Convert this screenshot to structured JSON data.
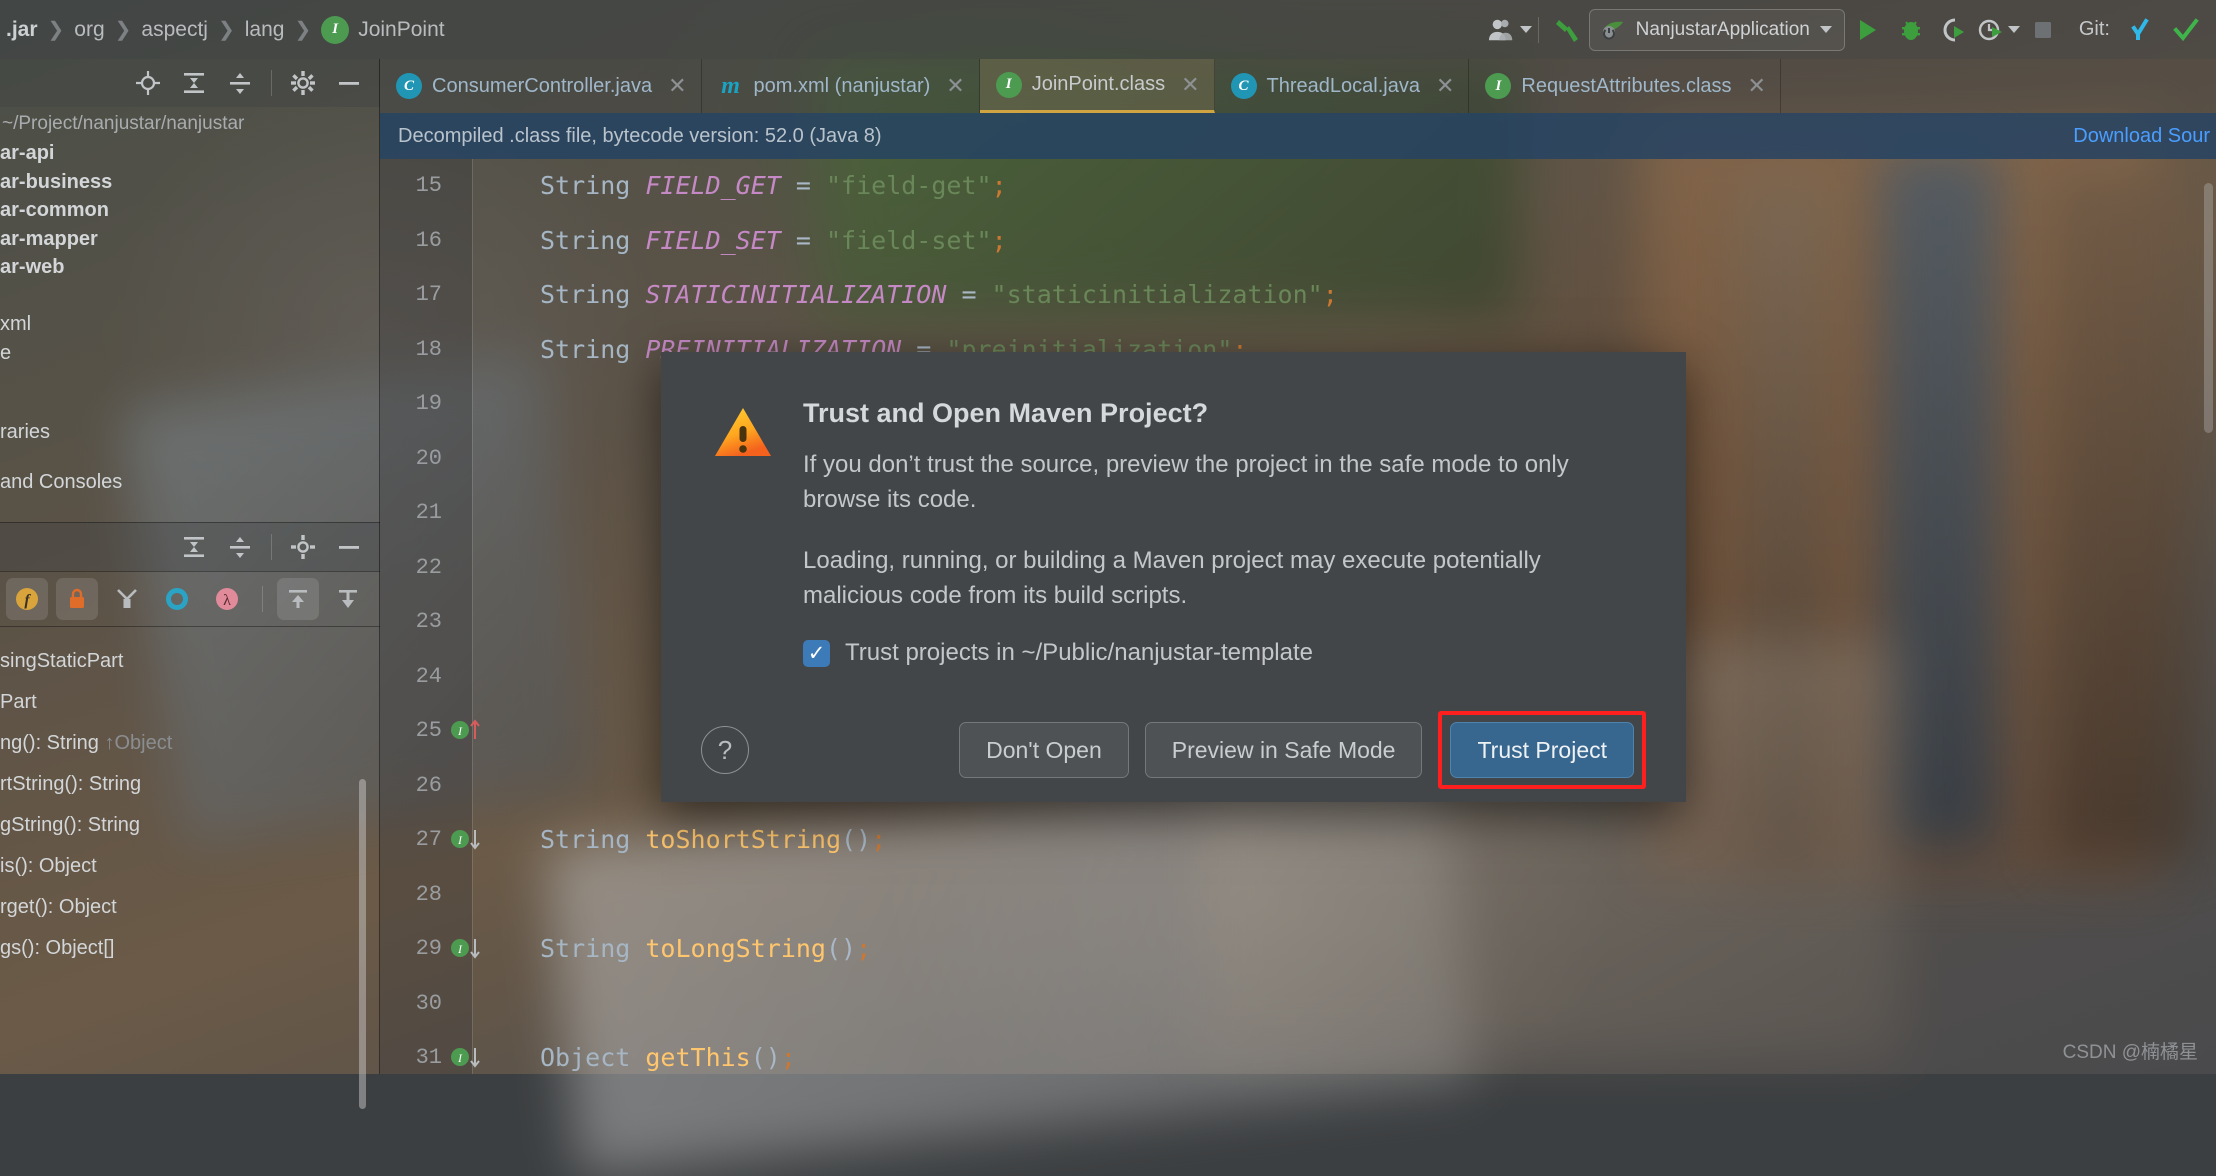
{
  "toolbar": {
    "breadcrumb": [
      {
        "label": ".jar",
        "bold": true
      },
      {
        "label": "org",
        "bold": false
      },
      {
        "label": "aspectj",
        "bold": false
      },
      {
        "label": "lang",
        "bold": false
      },
      {
        "label": "JoinPoint",
        "bold": false,
        "icon": "interface-badge",
        "badge_letter": "I"
      }
    ],
    "separator": "❯",
    "icons": [
      {
        "name": "user-account-icon",
        "glyph": "👤"
      },
      {
        "name": "build-hammer-icon",
        "glyph": "hammer"
      }
    ],
    "run_config": {
      "label": "NanjustarApplication",
      "icon": "spring-boot-icon"
    },
    "run_icons": [
      {
        "name": "run-button",
        "glyph": "▶"
      },
      {
        "name": "debug-button",
        "glyph": "bug"
      },
      {
        "name": "run-with-coverage-button",
        "glyph": "coverage"
      },
      {
        "name": "profiler-button",
        "glyph": "profiler"
      },
      {
        "name": "stop-button",
        "glyph": "■"
      }
    ],
    "git_label": "Git:",
    "git_icons": [
      {
        "name": "git-update-project-icon",
        "glyph": "↙"
      },
      {
        "name": "git-commit-icon",
        "glyph": "✓"
      }
    ]
  },
  "project_panel": {
    "toolbar_icons": [
      {
        "name": "select-opened-file-icon"
      },
      {
        "name": "expand-all-icon"
      },
      {
        "name": "collapse-all-icon"
      },
      {
        "name": "settings-gear-icon"
      },
      {
        "name": "hide-panel-icon"
      }
    ],
    "path": "~/Project/nanjustar/nanjustar",
    "tree": [
      {
        "label": "ar-api",
        "bold": true
      },
      {
        "label": "ar-business",
        "bold": true
      },
      {
        "label": "ar-common",
        "bold": true
      },
      {
        "label": "ar-mapper",
        "bold": true
      },
      {
        "label": "ar-web",
        "bold": true
      },
      {
        "label": "",
        "bold": false
      },
      {
        "label": "xml",
        "bold": false
      },
      {
        "label": "e",
        "bold": false
      },
      {
        "label": "",
        "bold": false
      },
      {
        "label": "raries",
        "bold": false
      },
      {
        "label": "and Consoles",
        "bold": false
      }
    ],
    "split_toolbar_icons": [
      {
        "name": "expand-all-icon"
      },
      {
        "name": "collapse-all-icon"
      },
      {
        "name": "settings-gear-icon"
      },
      {
        "name": "hide-panel-icon"
      }
    ],
    "structure_icons": [
      {
        "name": "fields-filter-icon",
        "glyph": "f",
        "color": "#d9a43b"
      },
      {
        "name": "non-public-filter-icon",
        "glyph": "lock",
        "color": "#e06c29"
      },
      {
        "name": "inherited-filter-icon",
        "glyph": "Y",
        "color": "#b9bcbe"
      },
      {
        "name": "properties-filter-icon",
        "glyph": "O",
        "color": "#2aa3c4"
      },
      {
        "name": "lambdas-filter-icon",
        "glyph": "λ",
        "color": "#e08a9a"
      },
      {
        "name": "expand-all-icon",
        "glyph": "up",
        "color": "#b9bcbe"
      },
      {
        "name": "collapse-all-icon",
        "glyph": "down",
        "color": "#b9bcbe"
      }
    ],
    "structure": [
      {
        "text": "singStaticPart",
        "dim": ""
      },
      {
        "text": "Part",
        "dim": ""
      },
      {
        "text": "ng(): String",
        "dim": "↑Object"
      },
      {
        "text": "rtString(): String",
        "dim": ""
      },
      {
        "text": "gString(): String",
        "dim": ""
      },
      {
        "text": "is(): Object",
        "dim": ""
      },
      {
        "text": "rget(): Object",
        "dim": ""
      },
      {
        "text": "gs(): Object[]",
        "dim": ""
      }
    ]
  },
  "editor_tabs": [
    {
      "label": "ConsumerController.java",
      "icon": "class-file-icon",
      "badge": "C",
      "active": false,
      "close": "✕"
    },
    {
      "label": "pom.xml (nanjustar)",
      "icon": "maven-file-icon",
      "badge": "m",
      "active": false,
      "close": "✕"
    },
    {
      "label": "JoinPoint.class",
      "icon": "interface-file-icon",
      "badge": "I",
      "active": true,
      "close": "✕"
    },
    {
      "label": "ThreadLocal.java",
      "icon": "class-file-icon",
      "badge": "C",
      "active": false,
      "close": "✕"
    },
    {
      "label": "RequestAttributes.class",
      "icon": "interface-file-icon",
      "badge": "I",
      "active": false,
      "close": "✕"
    }
  ],
  "notification": {
    "message": "Decompiled .class file, bytecode version: 52.0 (Java 8)",
    "action": "Download Sour"
  },
  "code": {
    "lines": [
      {
        "num": "15",
        "gutter": "",
        "tokens": [
          {
            "t": "String ",
            "c": "kw"
          },
          {
            "t": "FIELD_GET",
            "c": "fld"
          },
          {
            "t": " = ",
            "c": "op"
          },
          {
            "t": "\"field-get\"",
            "c": "str"
          },
          {
            "t": ";",
            "c": "semi"
          }
        ]
      },
      {
        "num": "16",
        "gutter": "",
        "tokens": [
          {
            "t": "String ",
            "c": "kw"
          },
          {
            "t": "FIELD_SET",
            "c": "fld"
          },
          {
            "t": " = ",
            "c": "op"
          },
          {
            "t": "\"field-set\"",
            "c": "str"
          },
          {
            "t": ";",
            "c": "semi"
          }
        ]
      },
      {
        "num": "17",
        "gutter": "",
        "tokens": [
          {
            "t": "String ",
            "c": "kw"
          },
          {
            "t": "STATICINITIALIZATION",
            "c": "fld"
          },
          {
            "t": " = ",
            "c": "op"
          },
          {
            "t": "\"staticinitialization\"",
            "c": "str"
          },
          {
            "t": ";",
            "c": "semi"
          }
        ]
      },
      {
        "num": "18",
        "gutter": "",
        "tokens": [
          {
            "t": "String ",
            "c": "kw"
          },
          {
            "t": "PREINITIALIZATION",
            "c": "fld"
          },
          {
            "t": " = ",
            "c": "op"
          },
          {
            "t": "\"preinitialization\"",
            "c": "str"
          },
          {
            "t": ";",
            "c": "semi"
          }
        ]
      },
      {
        "num": "19",
        "gutter": "",
        "tokens": []
      },
      {
        "num": "20",
        "gutter": "",
        "tokens": []
      },
      {
        "num": "21",
        "gutter": "",
        "tokens": []
      },
      {
        "num": "22",
        "gutter": "",
        "tokens": []
      },
      {
        "num": "23",
        "gutter": "",
        "tokens": []
      },
      {
        "num": "24",
        "gutter": "",
        "tokens": []
      },
      {
        "num": "25",
        "gutter": "impl-up",
        "tokens": []
      },
      {
        "num": "26",
        "gutter": "",
        "tokens": []
      },
      {
        "num": "27",
        "gutter": "impl-down",
        "tokens": [
          {
            "t": "String ",
            "c": "kw"
          },
          {
            "t": "toShortString",
            "c": "mth"
          },
          {
            "t": "()",
            "c": "op"
          },
          {
            "t": ";",
            "c": "semi"
          }
        ]
      },
      {
        "num": "28",
        "gutter": "",
        "tokens": []
      },
      {
        "num": "29",
        "gutter": "impl-down",
        "tokens": [
          {
            "t": "String ",
            "c": "kw"
          },
          {
            "t": "toLongString",
            "c": "mth"
          },
          {
            "t": "()",
            "c": "op"
          },
          {
            "t": ";",
            "c": "semi"
          }
        ]
      },
      {
        "num": "30",
        "gutter": "",
        "tokens": []
      },
      {
        "num": "31",
        "gutter": "impl-down",
        "tokens": [
          {
            "t": "Object ",
            "c": "kw"
          },
          {
            "t": "getThis",
            "c": "mth"
          },
          {
            "t": "()",
            "c": "op"
          },
          {
            "t": ";",
            "c": "semi"
          }
        ]
      }
    ]
  },
  "dialog": {
    "title": "Trust and Open Maven Project?",
    "paragraph1": "If you don’t trust the source, preview the project in the safe mode to only browse its code.",
    "paragraph2": "Loading, running, or building a Maven project may execute potentially malicious code from its build scripts.",
    "checkbox": {
      "label": "Trust projects in ~/Public/nanjustar-template",
      "checked": true,
      "mark": "✓"
    },
    "help_glyph": "?",
    "buttons": [
      {
        "label": "Don't Open",
        "primary": false,
        "highlighted": false
      },
      {
        "label": "Preview in Safe Mode",
        "primary": false,
        "highlighted": false
      },
      {
        "label": "Trust Project",
        "primary": true,
        "highlighted": true
      }
    ],
    "highlight_color": "#ff1f1f",
    "primary_color": "#37668f"
  },
  "watermark": "CSDN @楠橘星"
}
